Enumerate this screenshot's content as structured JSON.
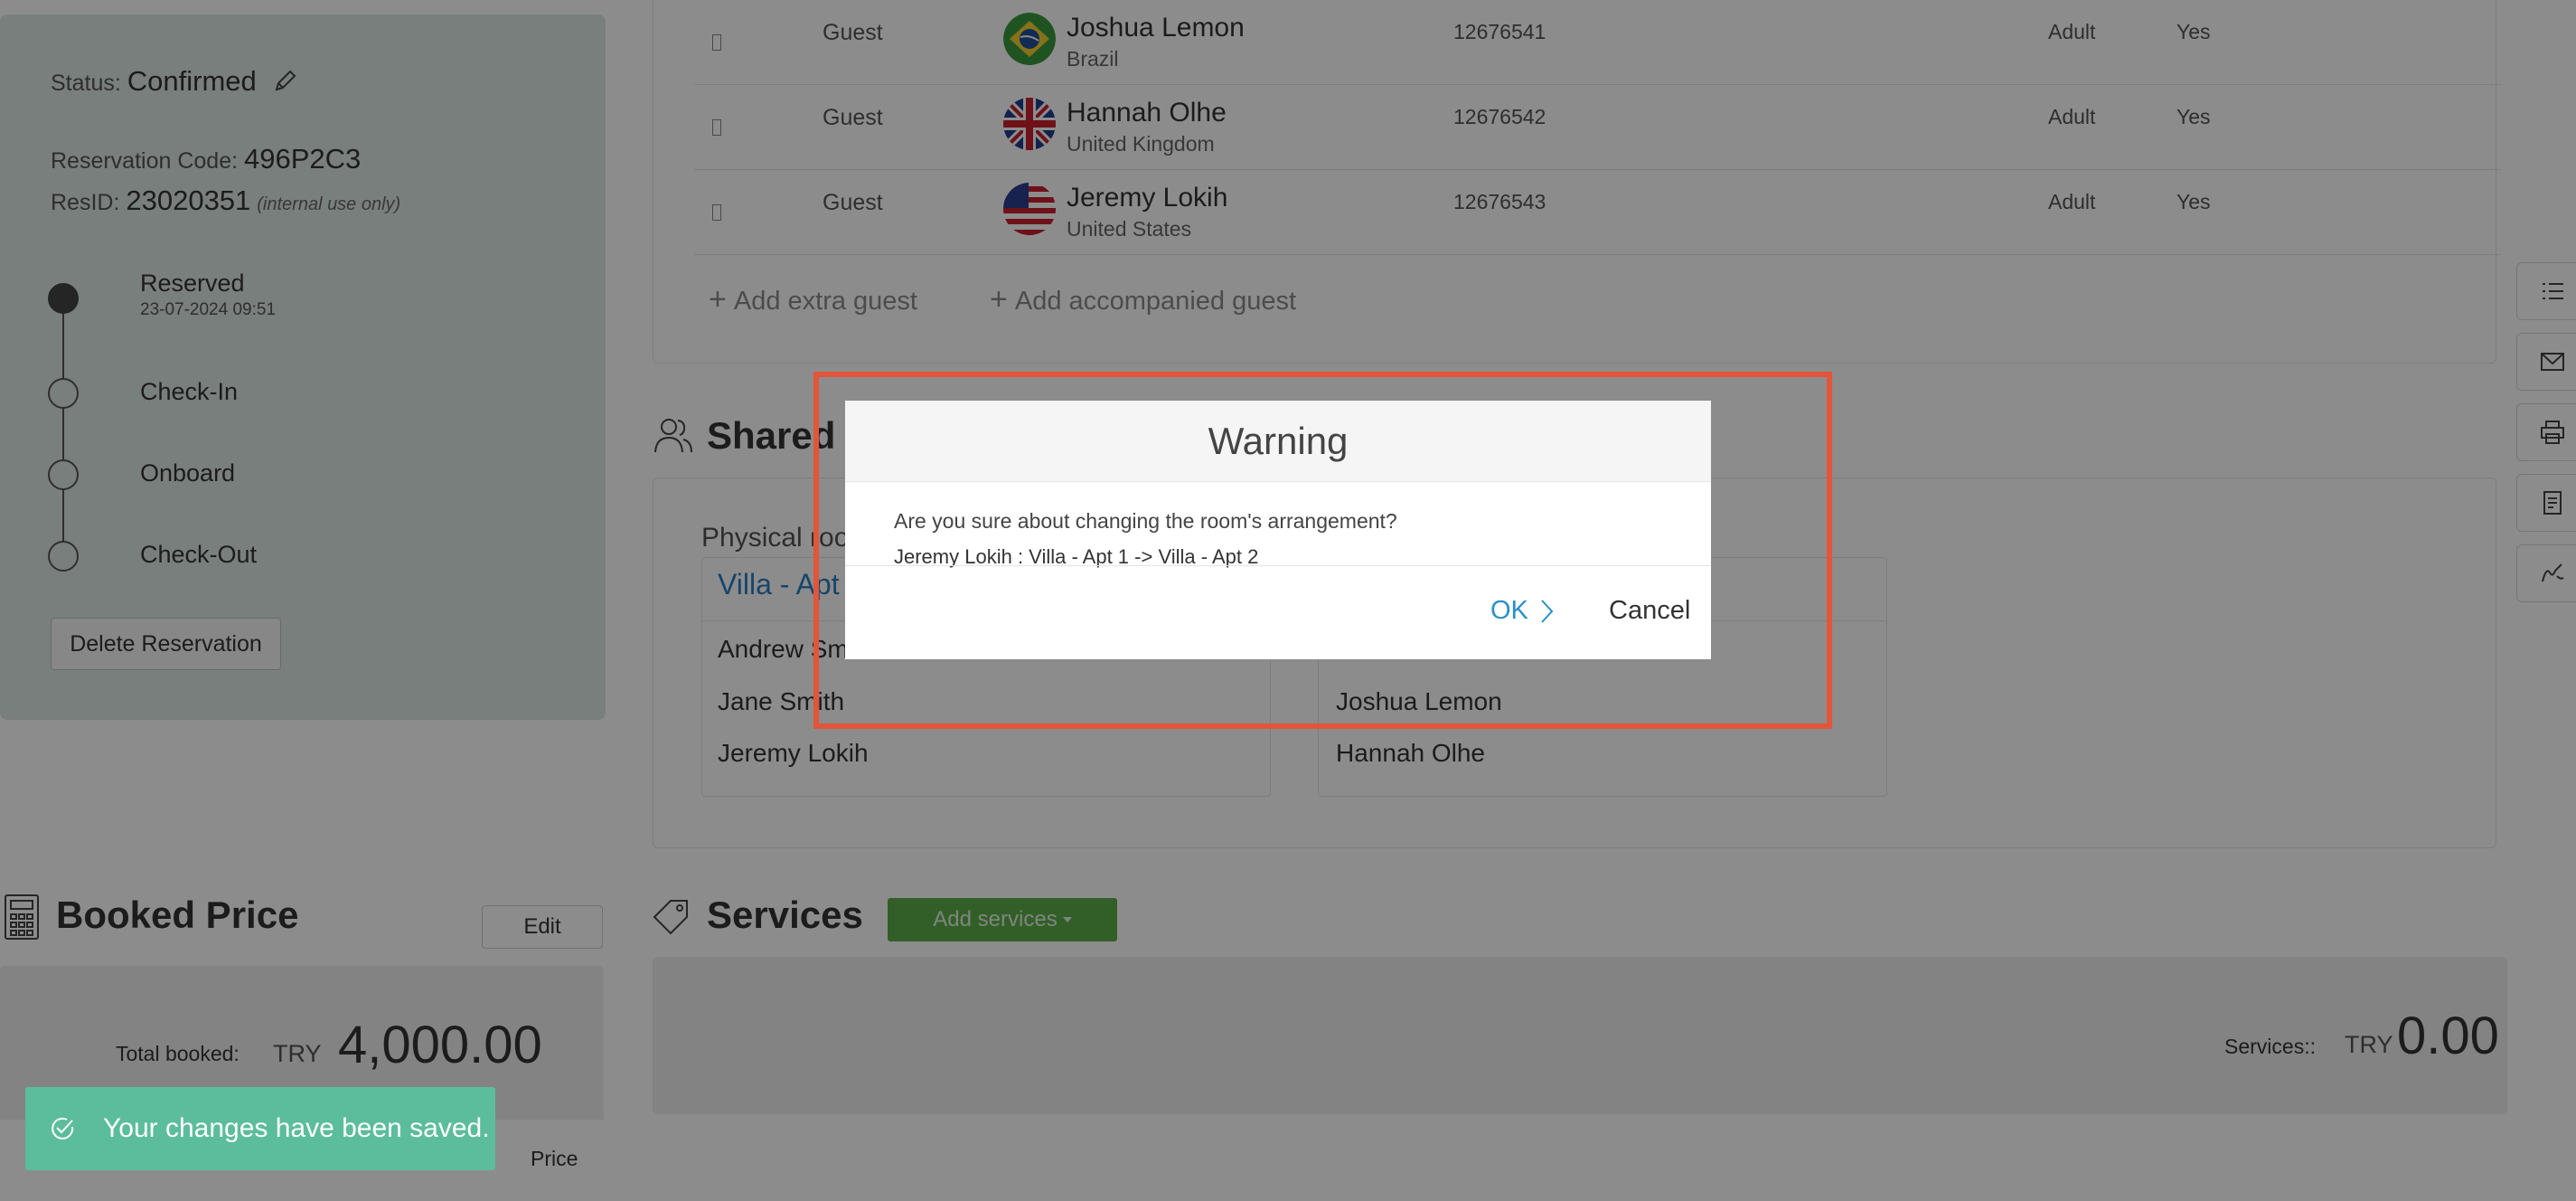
{
  "reservation": {
    "status_label": "Status:",
    "status_value": "Confirmed",
    "code_label": "Reservation Code:",
    "code_value": "496P2C3",
    "resid_label": "ResID:",
    "resid_value": "23020351",
    "resid_note": "(internal use only)",
    "timeline": [
      {
        "label": "Reserved",
        "timestamp": "23-07-2024 09:51",
        "completed": true
      },
      {
        "label": "Check-In",
        "completed": false
      },
      {
        "label": "Onboard",
        "completed": false
      },
      {
        "label": "Check-Out",
        "completed": false
      }
    ],
    "delete_label": "Delete Reservation"
  },
  "guests": {
    "rows": [
      {
        "type": "Guest",
        "name": "Joshua Lemon",
        "country": "Brazil",
        "number": "12676541",
        "age_group": "Adult",
        "flag": "Yes"
      },
      {
        "type": "Guest",
        "name": "Hannah Olhe",
        "country": "United Kingdom",
        "number": "12676542",
        "age_group": "Adult",
        "flag": "Yes"
      },
      {
        "type": "Guest",
        "name": "Jeremy Lokih",
        "country": "United States",
        "number": "12676543",
        "age_group": "Adult",
        "flag": "Yes"
      }
    ],
    "add_extra": "Add extra guest",
    "add_accompanied": "Add accompanied guest"
  },
  "shared": {
    "title": "Shared",
    "physical_label": "Physical roo",
    "rooms": [
      {
        "title": "Villa - Apt",
        "occupants": [
          "Andrew Sm",
          "Jane Smith",
          "Jeremy Lokih"
        ]
      },
      {
        "title": "",
        "occupants": [
          "",
          "Joshua Lemon",
          "Hannah Olhe"
        ]
      }
    ]
  },
  "booked_price": {
    "title": "Booked Price",
    "edit_label": "Edit",
    "total_label": "Total booked:",
    "currency": "TRY",
    "amount": "4,000.00",
    "price_col": "Price"
  },
  "services": {
    "title": "Services",
    "add_label": "Add services",
    "total_label": "Services::",
    "currency": "TRY",
    "amount": "0.00"
  },
  "dialog": {
    "title": "Warning",
    "message": "Are you sure about changing the room's arrangement?",
    "detail": "Jeremy Lokih : Villa - Apt 1 -> Villa - Apt 2",
    "ok_label": "OK",
    "cancel_label": "Cancel"
  },
  "toast": {
    "message": "Your changes have been saved."
  },
  "colors": {
    "accent": "#2a8fc7",
    "highlight": "#e2553a",
    "toast": "#5bbd9b",
    "add_services": "#5cae4a"
  }
}
